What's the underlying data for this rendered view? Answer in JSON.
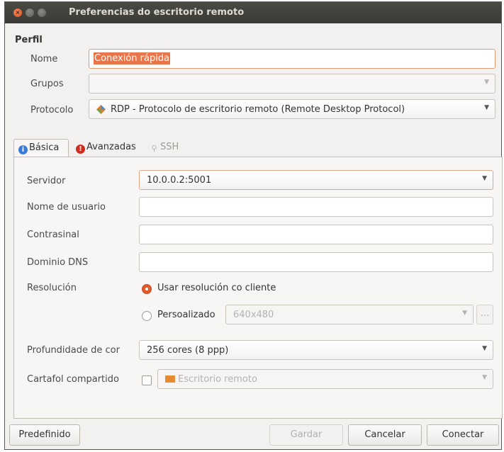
{
  "window": {
    "title": "Preferencias do escritorio remoto"
  },
  "profile": {
    "section_title": "Perfil",
    "name_label": "Nome",
    "name_value": "Conexión rápida",
    "groups_label": "Grupos",
    "groups_value": "",
    "protocol_label": "Protocolo",
    "protocol_value": "RDP - Protocolo de escritorio remoto (Remote Desktop Protocol)"
  },
  "tabs": [
    {
      "label": "Básica",
      "icon": "info-icon"
    },
    {
      "label": "Avanzadas",
      "icon": "warning-icon"
    },
    {
      "label": "SSH",
      "icon": "ssh-icon"
    }
  ],
  "basic": {
    "server_label": "Servidor",
    "server_value": "10.0.0.2:5001",
    "username_label": "Nome de usuario",
    "username_value": "",
    "password_label": "Contrasinal",
    "password_value": "",
    "dns_label": "Dominio DNS",
    "dns_value": "",
    "resolution_label": "Resolución",
    "resolution_option_client": "Usar resolución co cliente",
    "resolution_option_custom": "Persoalizado",
    "custom_resolution_value": "640x480",
    "more_button": "...",
    "color_depth_label": "Profundidade de cor",
    "color_depth_value": "256 cores (8 ppp)",
    "shared_folder_label": "Cartafol compartido",
    "shared_folder_value": "Escritorio remoto"
  },
  "footer": {
    "default_button": "Predefinido",
    "save_button": "Gardar",
    "cancel_button": "Cancelar",
    "connect_button": "Conectar"
  },
  "colors": {
    "accent": "#e2592b",
    "titlebar": "#3c3b37"
  }
}
